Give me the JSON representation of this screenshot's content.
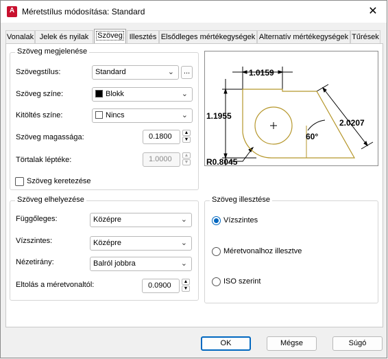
{
  "window": {
    "title": "Méretstílus módosítása: Standard",
    "app_icon_letter": "A",
    "close_glyph": "✕"
  },
  "tabs": [
    "Vonalak",
    "Jelek és nyilak",
    "Szöveg",
    "Illesztés",
    "Elsődleges mértékegységek",
    "Alternatív mértékegységek",
    "Tűrések"
  ],
  "active_tab": "Szöveg",
  "appearance": {
    "group_title": "Szöveg megjelenése",
    "style_label": "Szövegstílus:",
    "style_value": "Standard",
    "style_browse": "...",
    "color_label": "Szöveg színe:",
    "color_value": "Blokk",
    "fill_label": "Kitöltés színe:",
    "fill_value": "Nincs",
    "height_label": "Szöveg magassága:",
    "height_value": "0.1800",
    "fraction_label": "Törtalak léptéke:",
    "fraction_value": "1.0000",
    "frame_label": "Szöveg keretezése",
    "frame_checked": false
  },
  "placement": {
    "group_title": "Szöveg elhelyezése",
    "vertical_label": "Függőleges:",
    "vertical_value": "Középre",
    "horizontal_label": "Vízszintes:",
    "horizontal_value": "Középre",
    "direction_label": "Nézetirány:",
    "direction_value": "Balról jobbra",
    "offset_label": "Eltolás a méretvonaltól:",
    "offset_value": "0.0900"
  },
  "alignment": {
    "group_title": "Szöveg illesztése",
    "options": [
      "Vízszintes",
      "Méretvonalhoz illesztve",
      "ISO szerint"
    ],
    "selected": "Vízszintes"
  },
  "preview": {
    "dim_top": "1.0159",
    "dim_left": "1.1955",
    "dim_right": "2.0207",
    "dim_angle": "60°",
    "dim_radius": "R0.8045"
  },
  "buttons": {
    "ok": "OK",
    "cancel": "Mégse",
    "help": "Súgó"
  },
  "colors": {
    "accent": "#0067c0",
    "app_icon": "#c8102e",
    "preview_shape": "#b5962a"
  }
}
